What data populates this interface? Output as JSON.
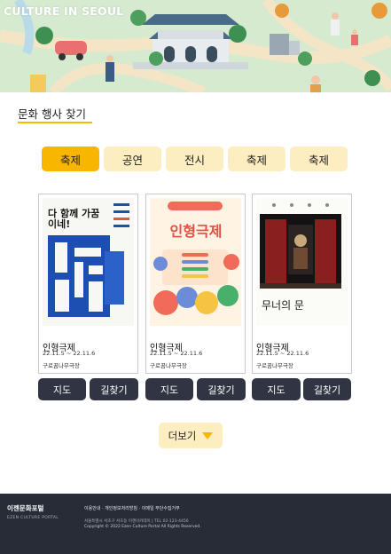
{
  "banner": {
    "title": "CULTURE IN SEOUL"
  },
  "section": {
    "title": "문화 행사 찾기"
  },
  "tabs": [
    {
      "label": "축제",
      "active": true
    },
    {
      "label": "공연",
      "active": false
    },
    {
      "label": "전시",
      "active": false
    },
    {
      "label": "축제",
      "active": false
    },
    {
      "label": "축제",
      "active": false
    }
  ],
  "cards": [
    {
      "title": "인형극제",
      "date": "22.11.5 ~ 22.11.6",
      "venue": "구로꿈나무극장",
      "poster_text": "다 함께 가꿈이네!",
      "map_label": "지도",
      "route_label": "길찾기"
    },
    {
      "title": "인형극제",
      "date": "22.11.5 ~ 22.11.6",
      "venue": "구로꿈나무극장",
      "poster_text": "인형극제",
      "map_label": "지도",
      "route_label": "길찾기"
    },
    {
      "title": "인형극제",
      "date": "22.11.5 ~ 22.11.6",
      "venue": "구로꿈나무극장",
      "poster_text": "무너의 문",
      "map_label": "지도",
      "route_label": "길찾기"
    }
  ],
  "more": {
    "label": "더보기"
  },
  "footer": {
    "logo": "이젠문화포털",
    "logo_sub": "EZEN CULTURE PORTAL",
    "links": "이용안내 · 개인정보처리방침 · 이메일 무단수집거부",
    "address": "서울특별시 서초구 서초동 이젠아카데미 | TEL 02-123-4456",
    "copyright": "Copyright © 2022 Ezen Culture Portal All Rights Reserved."
  },
  "colors": {
    "accent": "#f8b600",
    "tab_bg": "#fdeec2",
    "button_dark": "#303443",
    "footer_bg": "#272c36"
  }
}
